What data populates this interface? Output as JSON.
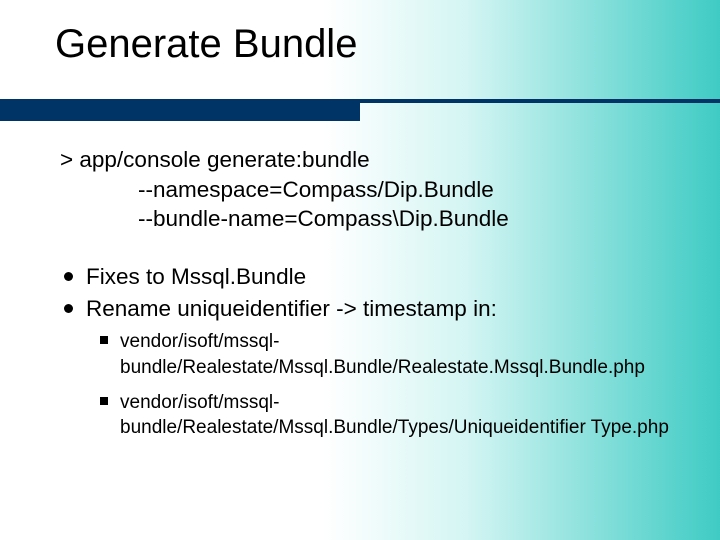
{
  "title": "Generate Bundle",
  "command": {
    "line1": "> app/console generate:bundle",
    "line2": "--namespace=Compass/Dip.Bundle",
    "line3": "--bundle-name=Compass\\Dip.Bundle"
  },
  "bullets": {
    "b1": "Fixes to Mssql.Bundle",
    "b2": "Rename uniqueidentifier -> timestamp in:",
    "sub1": "vendor/isoft/mssql-bundle/Realestate/Mssql.Bundle/Realestate.Mssql.Bundle.php",
    "sub2": "vendor/isoft/mssql-bundle/Realestate/Mssql.Bundle/Types/Uniqueidentifier Type.php"
  }
}
